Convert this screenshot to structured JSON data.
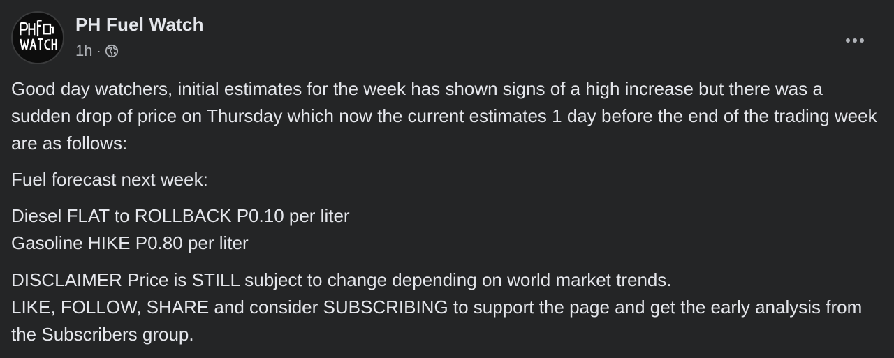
{
  "post": {
    "author": "PH Fuel Watch",
    "timestamp": "1h",
    "separator": "·",
    "audience_icon": "globe-icon",
    "more_icon": "more-options-icon",
    "avatar_text": "PH FUEL WATCH",
    "paragraphs": [
      [
        "Good day watchers, initial estimates for the week has shown signs of a high increase but there was a sudden drop of price on Thursday which now the current estimates 1 day before the end of the trading week are as follows:"
      ],
      [
        "Fuel forecast next week:"
      ],
      [
        "Diesel FLAT to ROLLBACK P0.10 per liter",
        "Gasoline HIKE P0.80 per liter"
      ],
      [
        "DISCLAIMER Price is STILL subject to change depending on world market trends.",
        "LIKE, FOLLOW, SHARE and consider SUBSCRIBING to support the page and get the early analysis from the Subscribers group."
      ]
    ]
  },
  "colors": {
    "background": "#242526",
    "primary_text": "#e4e6eb",
    "secondary_text": "#b0b3b8"
  }
}
